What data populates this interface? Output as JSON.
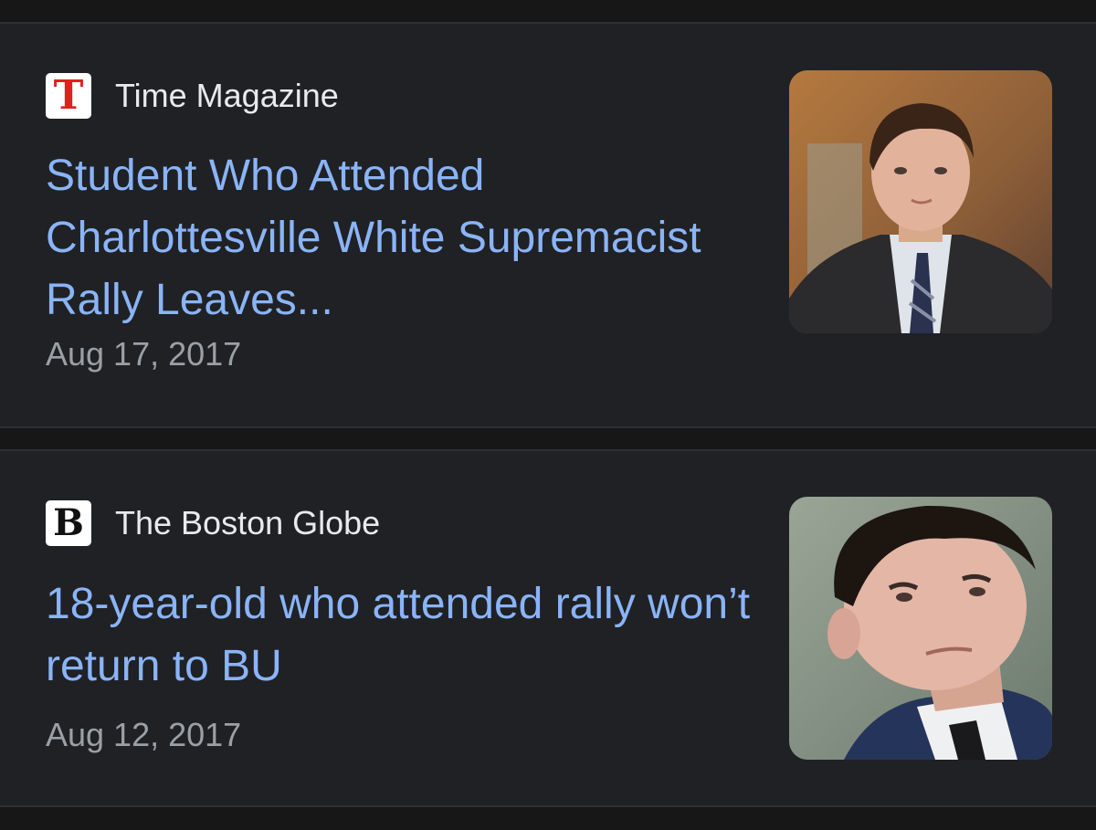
{
  "articles": [
    {
      "source": "Time Magazine",
      "favicon_letter": "T",
      "favicon_color": "#e0201c",
      "headline": "Student Who Attended Charlottesville White Supremacist Rally Leaves...",
      "date": "Aug 17, 2017",
      "thumbnail": "photo of young man in suit and striped tie"
    },
    {
      "source": "The Boston Globe",
      "favicon_letter": "B",
      "favicon_color": "#111111",
      "headline": "18-year-old who attended rally won’t return to BU",
      "date": "Aug 12, 2017",
      "thumbnail": "close-up photo of young man in suit"
    }
  ],
  "colors": {
    "background": "#171717",
    "card": "#202124",
    "headline": "#8ab4f8",
    "source": "#e8eaed",
    "date": "#9aa0a6"
  }
}
